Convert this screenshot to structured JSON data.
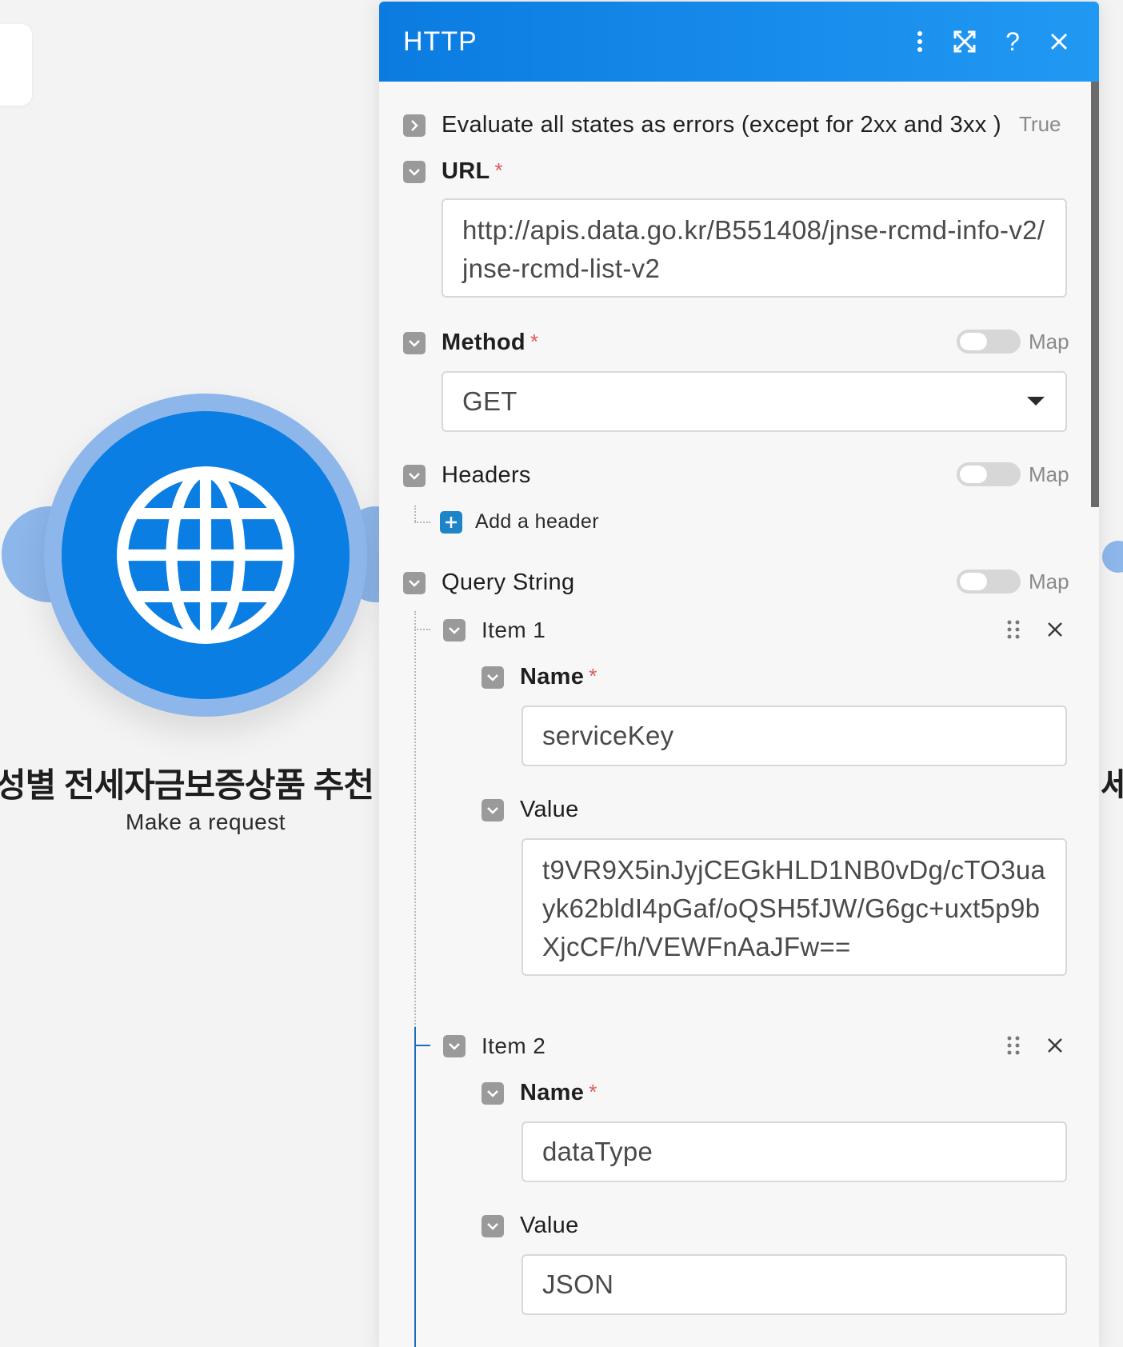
{
  "canvas": {
    "module_title": "성별 전세자금보증상품 추천 API",
    "module_subtitle": "Make a request",
    "right_peek_text": "세",
    "module_color": "#0a7ee3",
    "module_ring_color": "#8db6ea",
    "module_icon": "globe-icon"
  },
  "panel": {
    "title": "HTTP",
    "header_color": "#1a8cf0",
    "header_icons": [
      "more-vert-icon",
      "expand-icon",
      "help-icon",
      "close-icon"
    ],
    "evaluate_errors": {
      "label": "Evaluate all states as errors (except for 2xx and 3xx )",
      "value": "True"
    },
    "url": {
      "label": "URL",
      "required": "*",
      "value": "http://apis.data.go.kr/B551408/jnse-rcmd-info-v2/jnse-rcmd-list-v2"
    },
    "method": {
      "label": "Method",
      "required": "*",
      "map_label": "Map",
      "value": "GET"
    },
    "headers": {
      "label": "Headers",
      "map_label": "Map",
      "add_label": "Add a header"
    },
    "query_string": {
      "label": "Query String",
      "map_label": "Map",
      "items": [
        {
          "label": "Item 1",
          "name_label": "Name",
          "name_required": "*",
          "name_value": "serviceKey",
          "value_label": "Value",
          "value_value": "t9VR9X5inJyjCEGkHLD1NB0vDg/cTO3uayk62bldI4pGaf/oQSH5fJW/G6gc+uxt5p9bXjcCF/h/VEWFnAaJFw=="
        },
        {
          "label": "Item 2",
          "name_label": "Name",
          "name_required": "*",
          "name_value": "dataType",
          "value_label": "Value",
          "value_value": "JSON"
        }
      ]
    }
  }
}
